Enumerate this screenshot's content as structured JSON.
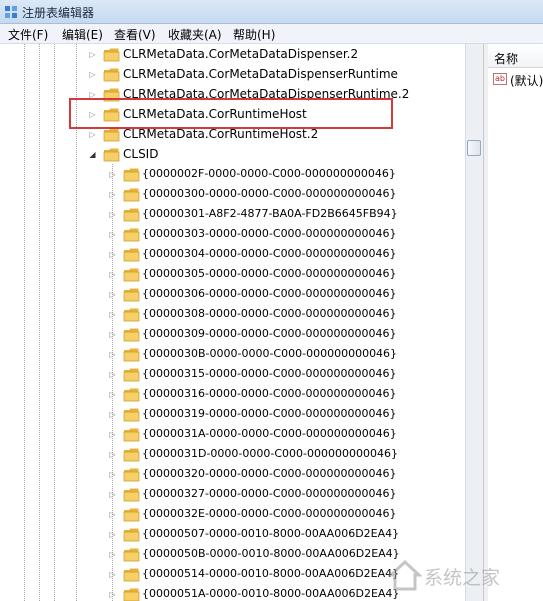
{
  "window": {
    "title": "注册表编辑器",
    "icon": "registry-editor-icon"
  },
  "menu": [
    {
      "label": "文件(F)",
      "name": "menu-file"
    },
    {
      "label": "编辑(E)",
      "name": "menu-edit"
    },
    {
      "label": "查看(V)",
      "name": "menu-view"
    },
    {
      "label": "收藏夹(A)",
      "name": "menu-favorites"
    },
    {
      "label": "帮助(H)",
      "name": "menu-help"
    }
  ],
  "tree": {
    "top_items": [
      {
        "label": "CLRMetaData.CorMetaDataDispenser.2",
        "state": "collapsed"
      },
      {
        "label": "CLRMetaData.CorMetaDataDispenserRuntime",
        "state": "collapsed"
      },
      {
        "label": "CLRMetaData.CorMetaDataDispenserRuntime.2",
        "state": "collapsed"
      },
      {
        "label": "CLRMetaData.CorRuntimeHost",
        "state": "collapsed"
      },
      {
        "label": "CLRMetaData.CorRuntimeHost.2",
        "state": "collapsed"
      },
      {
        "label": "CLSID",
        "state": "expanded",
        "highlighted": true
      }
    ],
    "clsid_children": [
      "{0000002F-0000-0000-C000-000000000046}",
      "{00000300-0000-0000-C000-000000000046}",
      "{00000301-A8F2-4877-BA0A-FD2B6645FB94}",
      "{00000303-0000-0000-C000-000000000046}",
      "{00000304-0000-0000-C000-000000000046}",
      "{00000305-0000-0000-C000-000000000046}",
      "{00000306-0000-0000-C000-000000000046}",
      "{00000308-0000-0000-C000-000000000046}",
      "{00000309-0000-0000-C000-000000000046}",
      "{0000030B-0000-0000-C000-000000000046}",
      "{00000315-0000-0000-C000-000000000046}",
      "{00000316-0000-0000-C000-000000000046}",
      "{00000319-0000-0000-C000-000000000046}",
      "{0000031A-0000-0000-C000-000000000046}",
      "{0000031D-0000-0000-C000-000000000046}",
      "{00000320-0000-0000-C000-000000000046}",
      "{00000327-0000-0000-C000-000000000046}",
      "{0000032E-0000-0000-C000-000000000046}",
      "{00000507-0000-0010-8000-00AA006D2EA4}",
      "{0000050B-0000-0010-8000-00AA006D2EA4}",
      "{00000514-0000-0010-8000-00AA006D2EA4}",
      "{0000051A-0000-0010-8000-00AA006D2EA4}"
    ]
  },
  "right_pane": {
    "column_header": "名称",
    "values": [
      {
        "icon": "string-value-icon",
        "name": "(默认)"
      }
    ]
  },
  "watermark": {
    "text": "系统之家"
  },
  "colors": {
    "highlight_box": "#d53a3a",
    "folder": "#f2c14e",
    "titlebar": "#c6d9ef"
  }
}
